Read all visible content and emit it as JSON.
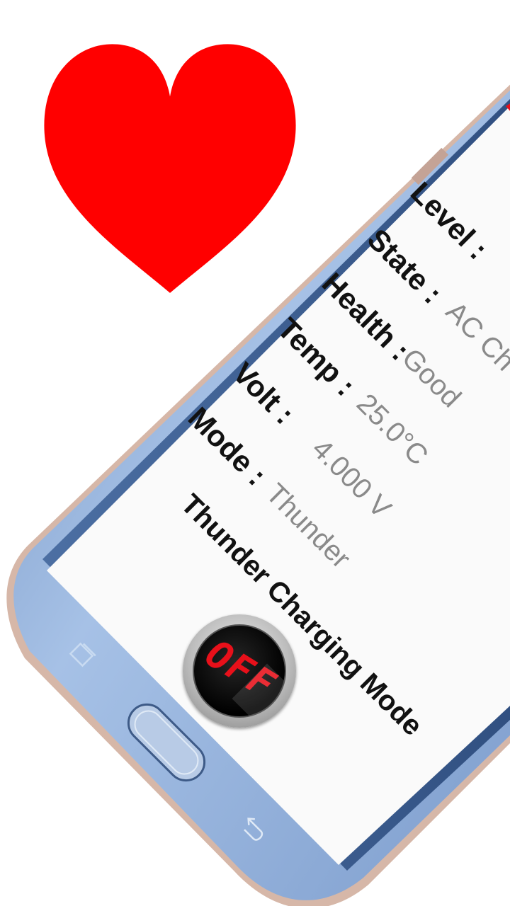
{
  "colors": {
    "heart": "#ff0000",
    "screen_bg": "#fafafa",
    "phone_body": "#8fb0d8",
    "label_text": "#111111",
    "value_text": "#8a8a8a",
    "led_red": "#e8101a"
  },
  "icons": [
    "heart-icon",
    "recent-apps-icon",
    "home-button",
    "back-icon"
  ],
  "battery": {
    "level_label": "Level :",
    "state_label": "State :",
    "state_value": "AC Ch",
    "health_label": "Health :",
    "health_value": "Good",
    "temp_label": "Temp :",
    "temp_value": "25.0°C",
    "volt_label": "Volt :",
    "volt_value": "4.000 V",
    "mode_label": "Mode :",
    "mode_value": "Thunder"
  },
  "charging": {
    "title": "Thunder Charging Mode",
    "toggle_text": "OFF"
  }
}
